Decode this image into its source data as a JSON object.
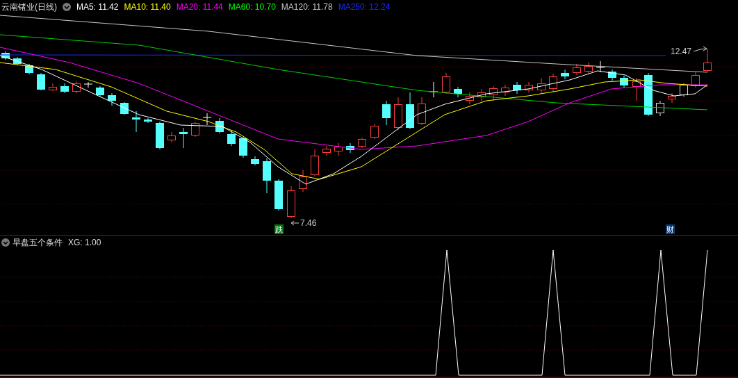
{
  "title": "云南锗业(日线)",
  "indicators": [
    {
      "label": "MA5: 11.42",
      "color": "#ffffff"
    },
    {
      "label": "MA10: 11.40",
      "color": "#ffff00"
    },
    {
      "label": "MA20: 11.44",
      "color": "#ff00ff"
    },
    {
      "label": "MA60: 10.70",
      "color": "#00ff00"
    },
    {
      "label": "MA120: 11.78",
      "color": "#c8c8c8"
    },
    {
      "label": "MA250: 12.24",
      "color": "#1a2aff"
    }
  ],
  "price_labels": {
    "low": "7.46",
    "high": "12.47"
  },
  "markers": [
    {
      "text": "跌",
      "color": "#007a10"
    },
    {
      "text": "财",
      "color": "#0c3c78"
    }
  ],
  "lower_pane": {
    "title": "早盘五个条件",
    "reading": "XG: 1.00"
  }
}
